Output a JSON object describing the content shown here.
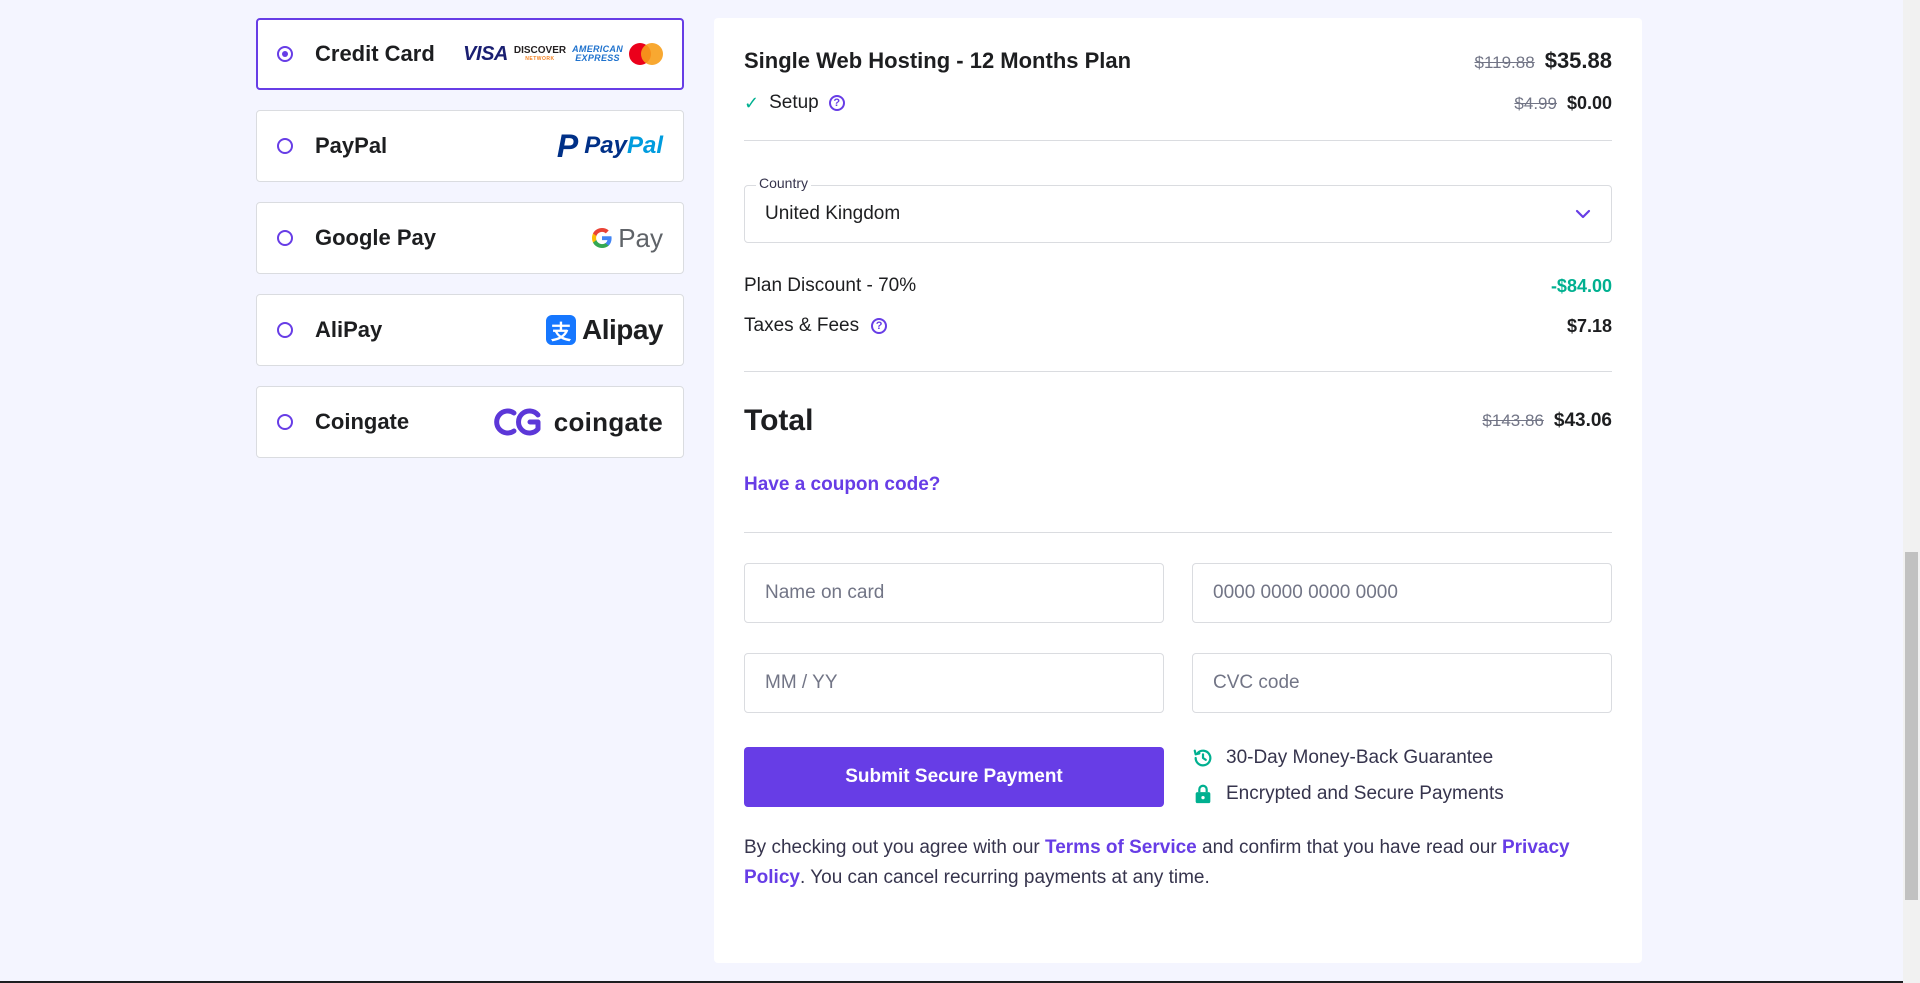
{
  "payment_methods": [
    {
      "label": "Credit Card",
      "selected": true
    },
    {
      "label": "PayPal",
      "selected": false
    },
    {
      "label": "Google Pay",
      "selected": false
    },
    {
      "label": "AliPay",
      "selected": false
    },
    {
      "label": "Coingate",
      "selected": false
    }
  ],
  "logos": {
    "visa": "VISA",
    "discover": "DISCOVER",
    "discover_sub": "NETWORK",
    "amex_1": "AMERICAN",
    "amex_2": "EXPRESS",
    "paypal_mark": "P",
    "paypal_a": "Pay",
    "paypal_b": "Pal",
    "gpay_g": "G",
    "gpay_text": "Pay",
    "alipay_mark": "支",
    "alipay_text": "Alipay",
    "coingate_text": "coingate"
  },
  "summary": {
    "plan_title": "Single Web Hosting - 12 Months Plan",
    "plan_old_price": "$119.88",
    "plan_new_price": "$35.88",
    "setup_label": "Setup",
    "setup_old_price": "$4.99",
    "setup_new_price": "$0.00",
    "country_legend": "Country",
    "country_value": "United Kingdom",
    "discount_label": "Plan Discount - 70%",
    "discount_value": "-$84.00",
    "taxes_label": "Taxes & Fees",
    "taxes_value": "$7.18",
    "total_label": "Total",
    "total_old_price": "$143.86",
    "total_new_price": "$43.06",
    "coupon_link": "Have a coupon code?"
  },
  "card_form": {
    "name_placeholder": "Name on card",
    "number_placeholder": "0000 0000 0000 0000",
    "expiry_placeholder": "MM / YY",
    "cvc_placeholder": "CVC code",
    "submit_label": "Submit Secure Payment"
  },
  "guarantees": {
    "money_back": "30-Day Money-Back Guarantee",
    "secure": "Encrypted and Secure Payments"
  },
  "legal": {
    "part1": "By checking out you agree with our ",
    "terms": "Terms of Service",
    "part2": " and confirm that you have read our ",
    "privacy": "Privacy Policy",
    "part3": ". You can cancel recurring payments at any time."
  },
  "colors": {
    "accent": "#673de6",
    "success": "#00b090",
    "background": "#f4f5ff"
  },
  "icons": {
    "setup_check": "check-icon",
    "help": "question-circle-icon",
    "country_dropdown": "chevron-down-icon",
    "money_back": "history-icon",
    "secure": "lock-icon"
  }
}
